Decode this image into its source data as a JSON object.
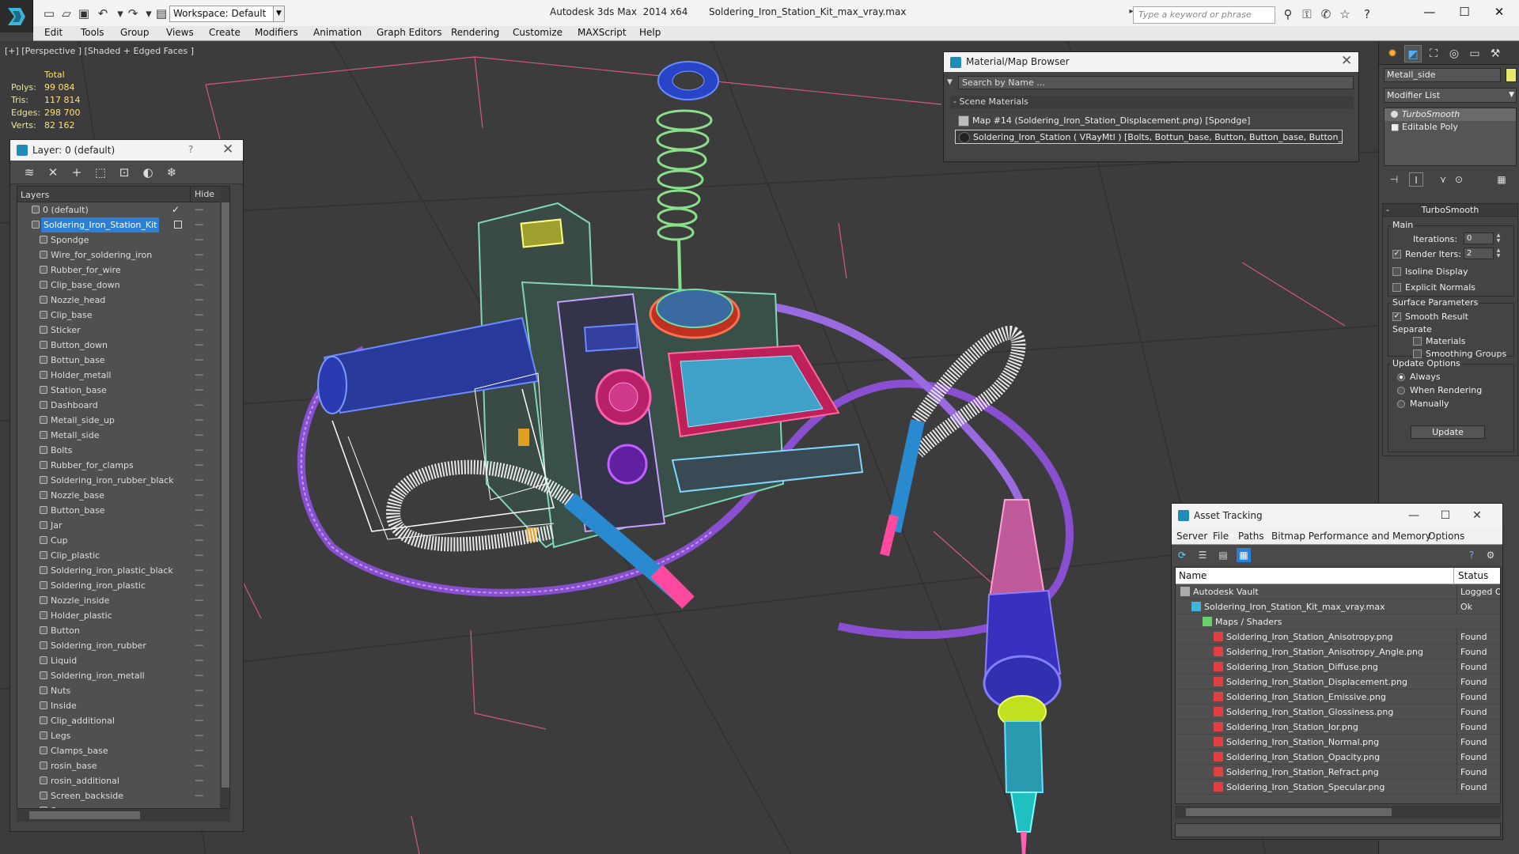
{
  "window": {
    "title": "Autodesk 3ds Max  2014 x64       Soldering_Iron_Station_Kit_max_vray.max",
    "workspace": "Workspace: Default",
    "search_placeholder": "Type a keyword or phrase",
    "minimize": "—",
    "maximize": "☐",
    "close": "✕"
  },
  "menu": [
    "Edit",
    "Tools",
    "Group",
    "Views",
    "Create",
    "Modifiers",
    "Animation",
    "Graph Editors",
    "Rendering",
    "Customize",
    "MAXScript",
    "Help"
  ],
  "viewport": {
    "label": "[+] [Perspective ] [Shaded + Edged Faces ]",
    "stats": {
      "header": "Total",
      "polys_label": "Polys:",
      "polys": "99 084",
      "tris_label": "Tris:",
      "tris": "117 814",
      "edges_label": "Edges:",
      "edges": "298 700",
      "verts_label": "Verts:",
      "verts": "82 162"
    }
  },
  "layer_panel": {
    "title": "Layer: 0 (default)",
    "help": "?",
    "close": "✕",
    "col_layers": "Layers",
    "col_hide": "Hide",
    "hide_marker": "----",
    "default_layer": "0 (default)",
    "default_check": "✓",
    "parent_layer": "Soldering_Iron_Station_Kit",
    "children": [
      "Spondge",
      "Wire_for_soldering_iron",
      "Rubber_for_wire",
      "Clip_base_down",
      "Nozzle_head",
      "Clip_base",
      "Sticker",
      "Button_down",
      "Bottun_base",
      "Holder_metall",
      "Station_base",
      "Dashboard",
      "Metall_side_up",
      "Metall_side",
      "Bolts",
      "Rubber_for_clamps",
      "Soldering_iron_rubber_black",
      "Nozzle_base",
      "Button_base",
      "Jar",
      "Cup",
      "Clip_plastic",
      "Soldering_iron_plastic_black",
      "Soldering_iron_plastic",
      "Nozzle_inside",
      "Holder_plastic",
      "Button",
      "Soldering_iron_rubber",
      "Liquid",
      "Soldering_iron_metall",
      "Nuts",
      "Inside",
      "Clip_additional",
      "Legs",
      "Clamps_base",
      "rosin_base",
      "rosin_additional",
      "Screen_backside",
      "Screen"
    ]
  },
  "material_browser": {
    "title": "Material/Map Browser",
    "close": "✕",
    "search_placeholder": "Search by Name ...",
    "group": "- Scene Materials",
    "items": [
      "Map #14 (Soldering_Iron_Station_Displacement.png) [Spondge]",
      "Soldering_Iron_Station  ( VRayMtl )  [Bolts, Bottun_base, Button, Button_base, Button_dow..."
    ]
  },
  "command_panel": {
    "object_name": "Metall_side",
    "object_color": "#e8e86a",
    "modifier_list": "Modifier List",
    "stack": [
      "TurboSmooth",
      "Editable Poly"
    ],
    "rollout_title": "TurboSmooth",
    "main_group": "Main",
    "iterations_label": "Iterations:",
    "iterations": "0",
    "render_iters_label": "Render Iters:",
    "render_iters": "2",
    "isoline": "Isoline Display",
    "explicit_normals": "Explicit Normals",
    "surface_group": "Surface Parameters",
    "smooth_result": "Smooth Result",
    "separate": "Separate",
    "materials": "Materials",
    "smoothing_groups": "Smoothing Groups",
    "update_group": "Update Options",
    "always": "Always",
    "when_rendering": "When Rendering",
    "manually": "Manually",
    "update_button": "Update",
    "checked": "✓"
  },
  "asset_tracking": {
    "title": "Asset Tracking",
    "menu": [
      "Server",
      "File",
      "Paths",
      "Bitmap Performance and Memory",
      "Options"
    ],
    "col_name": "Name",
    "col_status": "Status",
    "rows": [
      {
        "name": "Autodesk Vault",
        "status": "Logged Ou",
        "level": 0
      },
      {
        "name": "Soldering_Iron_Station_Kit_max_vray.max",
        "status": "Ok",
        "level": 1
      },
      {
        "name": "Maps / Shaders",
        "status": "",
        "level": 2
      },
      {
        "name": "Soldering_Iron_Station_Anisotropy.png",
        "status": "Found",
        "level": 3
      },
      {
        "name": "Soldering_Iron_Station_Anisotropy_Angle.png",
        "status": "Found",
        "level": 3
      },
      {
        "name": "Soldering_Iron_Station_Diffuse.png",
        "status": "Found",
        "level": 3
      },
      {
        "name": "Soldering_Iron_Station_Displacement.png",
        "status": "Found",
        "level": 3
      },
      {
        "name": "Soldering_Iron_Station_Emissive.png",
        "status": "Found",
        "level": 3
      },
      {
        "name": "Soldering_Iron_Station_Glossiness.png",
        "status": "Found",
        "level": 3
      },
      {
        "name": "Soldering_Iron_Station_Ior.png",
        "status": "Found",
        "level": 3
      },
      {
        "name": "Soldering_Iron_Station_Normal.png",
        "status": "Found",
        "level": 3
      },
      {
        "name": "Soldering_Iron_Station_Opacity.png",
        "status": "Found",
        "level": 3
      },
      {
        "name": "Soldering_Iron_Station_Refract.png",
        "status": "Found",
        "level": 3
      },
      {
        "name": "Soldering_Iron_Station_Specular.png",
        "status": "Found",
        "level": 3
      }
    ]
  }
}
